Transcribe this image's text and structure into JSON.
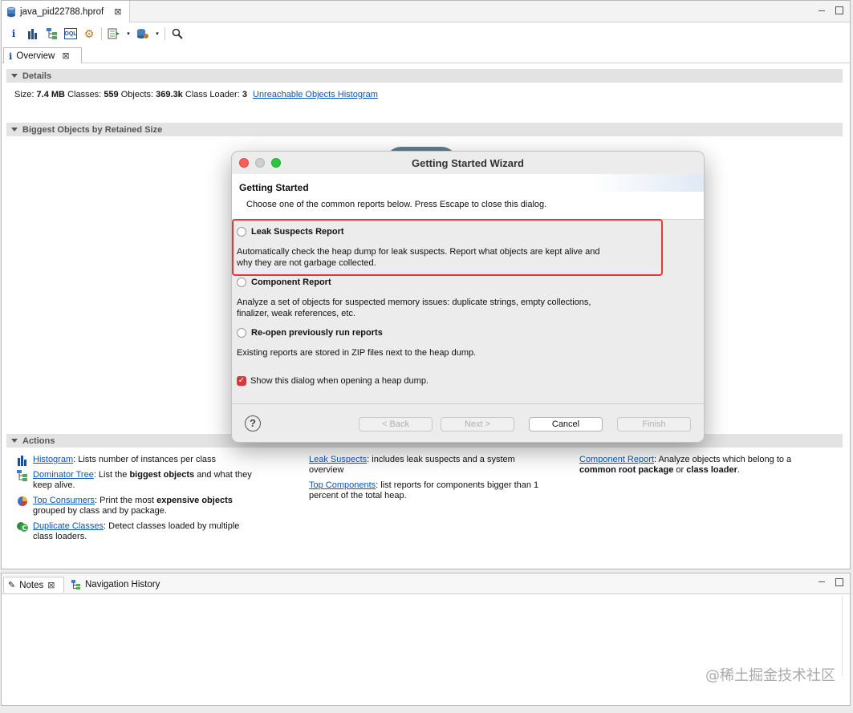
{
  "editor": {
    "tab_label": "java_pid22788.hprof",
    "overview_tab": "Overview"
  },
  "details": {
    "title": "Details",
    "size_label": "Size:",
    "size_value": "7.4 MB",
    "classes_label": "Classes:",
    "classes_value": "559",
    "objects_label": "Objects:",
    "objects_value": "369.3k",
    "loader_label": "Class Loader:",
    "loader_value": "3",
    "unreachable_link": "Unreachable Objects Histogram"
  },
  "biggest": {
    "title": "Biggest Objects by Retained Size"
  },
  "actions": {
    "title": "Actions",
    "col1": [
      {
        "link": "Histogram",
        "text": ": Lists number of instances per class",
        "icon": "histogram-icon"
      },
      {
        "link": "Dominator Tree",
        "text_pre": ": List the ",
        "bold": "biggest objects",
        "text_post": " and what they keep alive.",
        "icon": "dominator-tree-icon"
      },
      {
        "link": "Top Consumers",
        "text_pre": ": Print the most ",
        "bold": "expensive objects",
        "text_post": " grouped by class and by package.",
        "icon": "top-consumers-icon"
      },
      {
        "link": "Duplicate Classes",
        "text": ": Detect classes loaded by multiple class loaders.",
        "icon": "duplicate-classes-icon"
      }
    ],
    "col2": [
      {
        "link": "Leak Suspects",
        "text": ": includes leak suspects and a system overview"
      },
      {
        "link": "Top Components",
        "text": ": list reports for components bigger than 1 percent of the total heap."
      }
    ],
    "col3": [
      {
        "link": "Component Report",
        "text_pre": ": Analyze objects which belong to a ",
        "bold": "common root package",
        "mid": " or ",
        "bold2": "class loader",
        "text_post": "."
      }
    ]
  },
  "notes": {
    "notes_tab": "Notes",
    "history_tab": "Navigation History"
  },
  "watermark": "@稀土掘金技术社区",
  "dialog": {
    "title": "Getting Started Wizard",
    "header_title": "Getting Started",
    "header_sub": "Choose one of the common reports below. Press Escape to close this dialog.",
    "options": [
      {
        "label": "Leak Suspects Report",
        "desc": "Automatically check the heap dump for leak suspects. Report what objects are kept alive and why they are not garbage collected."
      },
      {
        "label": "Component Report",
        "desc": "Analyze a set of objects for suspected memory issues: duplicate strings, empty collections, finalizer, weak references, etc."
      },
      {
        "label": "Re-open previously run reports",
        "desc": "Existing reports are stored in ZIP files next to the heap dump."
      }
    ],
    "checkbox_label": "Show this dialog when opening a heap dump.",
    "buttons": {
      "back": "< Back",
      "next": "Next >",
      "cancel": "Cancel",
      "finish": "Finish"
    }
  }
}
